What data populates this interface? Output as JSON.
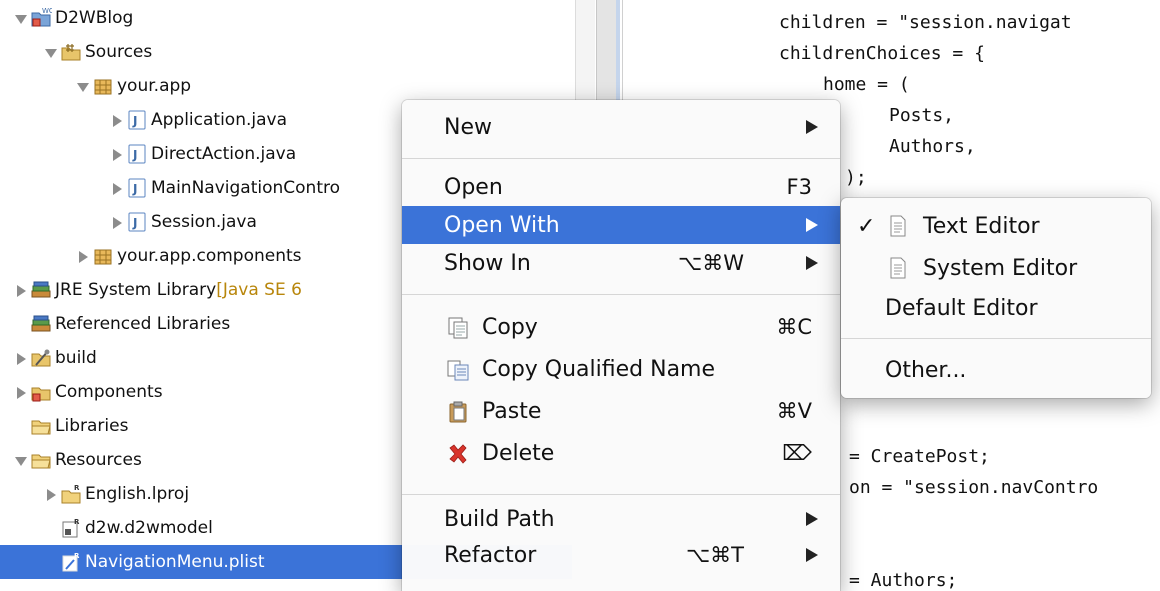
{
  "explorer": {
    "items": [
      {
        "label": "D2WBlog",
        "sub": "",
        "indent": 0,
        "twisty": "down",
        "icon": "project-icon"
      },
      {
        "label": "Sources",
        "sub": "",
        "indent": 1,
        "twisty": "down",
        "icon": "source-folder-icon"
      },
      {
        "label": "your.app",
        "sub": "",
        "indent": 2,
        "twisty": "down",
        "icon": "package-icon"
      },
      {
        "label": "Application.java",
        "sub": "",
        "indent": 3,
        "twisty": "right",
        "icon": "java-file-icon"
      },
      {
        "label": "DirectAction.java",
        "sub": "",
        "indent": 3,
        "twisty": "right",
        "icon": "java-file-icon"
      },
      {
        "label": "MainNavigationContro",
        "sub": "",
        "indent": 3,
        "twisty": "right",
        "icon": "java-file-icon"
      },
      {
        "label": "Session.java",
        "sub": "",
        "indent": 3,
        "twisty": "right",
        "icon": "java-file-icon"
      },
      {
        "label": "your.app.components",
        "sub": "",
        "indent": 2,
        "twisty": "right",
        "icon": "package-icon"
      },
      {
        "label": "JRE System Library ",
        "sub": "[Java SE 6",
        "indent": 0,
        "twisty": "right",
        "icon": "library-icon"
      },
      {
        "label": "Referenced Libraries",
        "sub": "",
        "indent": 0,
        "twisty": "none",
        "icon": "library-icon"
      },
      {
        "label": "build",
        "sub": "",
        "indent": 0,
        "twisty": "right",
        "icon": "build-folder-icon"
      },
      {
        "label": "Components",
        "sub": "",
        "indent": 0,
        "twisty": "right",
        "icon": "components-folder-icon"
      },
      {
        "label": "Libraries",
        "sub": "",
        "indent": 0,
        "twisty": "none",
        "icon": "folder-icon"
      },
      {
        "label": "Resources",
        "sub": "",
        "indent": 0,
        "twisty": "down",
        "icon": "folder-icon"
      },
      {
        "label": "English.lproj",
        "sub": "",
        "indent": 1,
        "twisty": "right",
        "icon": "resource-folder-icon"
      },
      {
        "label": "d2w.d2wmodel",
        "sub": "",
        "indent": 1,
        "twisty": "none",
        "icon": "model-file-icon"
      },
      {
        "label": "NavigationMenu.plist",
        "sub": "",
        "indent": 1,
        "twisty": "none",
        "icon": "plist-file-icon",
        "selected": true
      }
    ]
  },
  "editor": {
    "lines": [
      {
        "text": "children = \"session.navigat",
        "col": 0
      },
      {
        "text": "childrenChoices = {",
        "col": 0
      },
      {
        "text": "home = (",
        "col": 2
      },
      {
        "text": "Posts,",
        "col": 5
      },
      {
        "text": "Authors,",
        "col": 5
      },
      {
        "text": ");",
        "col": 3
      },
      {
        "text": "",
        "col": 0
      },
      {
        "text": "",
        "col": 0
      },
      {
        "text": "",
        "col": 0
      },
      {
        "text": "",
        "col": 0
      },
      {
        "text": "",
        "col": 0
      },
      {
        "text": "",
        "col": 0
      },
      {
        "text": "",
        "col": 0
      },
      {
        "text": "",
        "col": 0
      },
      {
        "text": "= CreatePost;",
        "col": 3
      },
      {
        "text": "on = \"session.navContro",
        "col": 3
      },
      {
        "text": "",
        "col": 0
      },
      {
        "text": "",
        "col": 0
      },
      {
        "text": "= Authors;",
        "col": 3
      }
    ]
  },
  "context_menu": {
    "items": [
      {
        "label": "New",
        "shortcut": "",
        "submenu": true,
        "icon": ""
      },
      {
        "label": "Open",
        "shortcut": "F3",
        "submenu": false,
        "icon": ""
      },
      {
        "label": "Open With",
        "shortcut": "",
        "submenu": true,
        "icon": "",
        "highlight": true
      },
      {
        "label": "Show In",
        "shortcut": "⌥⌘W",
        "submenu": true,
        "icon": ""
      },
      {
        "label": "Copy",
        "shortcut": "⌘C",
        "submenu": false,
        "icon": "copy-icon"
      },
      {
        "label": "Copy Qualified Name",
        "shortcut": "",
        "submenu": false,
        "icon": "copy-qualified-name-icon"
      },
      {
        "label": "Paste",
        "shortcut": "⌘V",
        "submenu": false,
        "icon": "paste-icon"
      },
      {
        "label": "Delete",
        "shortcut": "⌦",
        "submenu": false,
        "icon": "delete-icon"
      },
      {
        "label": "Build Path",
        "shortcut": "",
        "submenu": true,
        "icon": ""
      },
      {
        "label": "Refactor",
        "shortcut": "⌥⌘T",
        "submenu": true,
        "icon": ""
      }
    ]
  },
  "open_with_submenu": {
    "items": [
      {
        "label": "Text Editor",
        "checked": true,
        "icon": "text-file-icon"
      },
      {
        "label": "System Editor",
        "checked": false,
        "icon": "text-file-icon"
      },
      {
        "label": "Default Editor",
        "checked": false,
        "icon": ""
      },
      {
        "label": "Other...",
        "checked": false,
        "icon": ""
      }
    ],
    "check_mark": "✓"
  },
  "colors": {
    "selection": "#3b73d8",
    "delete_red": "#d9342b",
    "folder_yellow": "#e8c56a"
  }
}
